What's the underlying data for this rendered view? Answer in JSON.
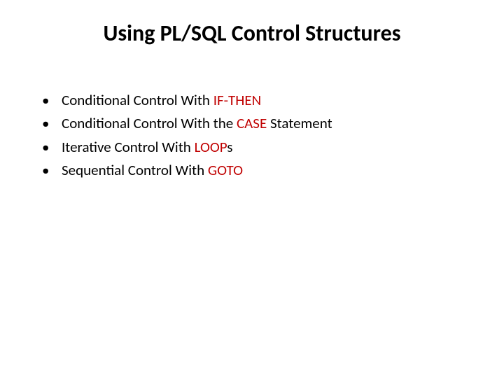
{
  "title": "Using PL/SQL Control Structures",
  "bullets": [
    {
      "pre": "Conditional Control With ",
      "hl": "IF-THEN",
      "post": ""
    },
    {
      "pre": "Conditional Control With the ",
      "hl": "CASE",
      "post": " Statement"
    },
    {
      "pre": "Iterative Control With ",
      "hl": "LOOP",
      "post": "s"
    },
    {
      "pre": "Sequential Control With ",
      "hl": "GOTO",
      "post": ""
    }
  ],
  "colors": {
    "highlight": "#c00000",
    "text": "#000000",
    "background": "#ffffff"
  }
}
